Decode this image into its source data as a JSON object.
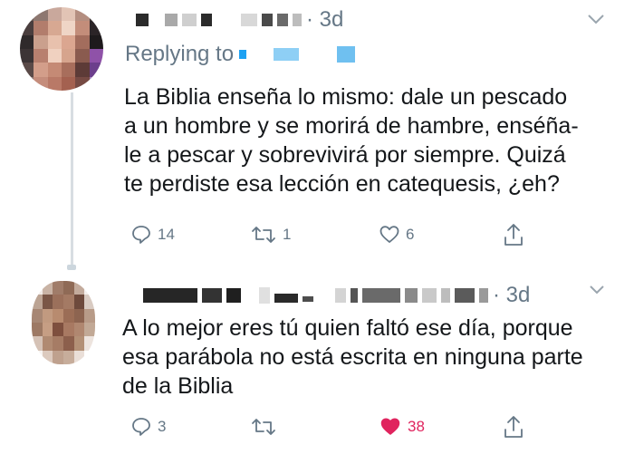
{
  "tweets": [
    {
      "time": "· 3d",
      "replying_label": "Replying to",
      "text": "La Biblia enseña lo mismo: dale un pescado a un hombre y se morirá de hambre, enséña-le a pescar y sobrevivirá por siempre. Quizá te perdiste esa lección en catequesis, ¿eh?",
      "lines": [
        "La Biblia enseña lo mismo: dale un pescado",
        "a un hombre y se morirá de hambre, enséña-",
        "le a pescar y sobrevivirá por siempre. Quizá",
        "te perdiste esa lección en catequesis, ¿eh?"
      ],
      "actions": {
        "replies": "14",
        "retweets": "1",
        "likes": "6"
      },
      "liked": false
    },
    {
      "time": "· 3d",
      "lines": [
        "A lo mejor eres tú quien faltó ese día, porque",
        "esa parábola no está escrita en ninguna parte",
        "de la Biblia"
      ],
      "actions": {
        "replies": "3",
        "retweets": "",
        "likes": "38"
      },
      "liked": true
    }
  ],
  "icons": [
    "reply-icon",
    "retweet-icon",
    "like-icon",
    "share-icon",
    "chevron-down-icon"
  ],
  "colors": {
    "muted": "#657786",
    "text": "#14171a",
    "like_active": "#e0245e",
    "line": "#d8dde2"
  }
}
